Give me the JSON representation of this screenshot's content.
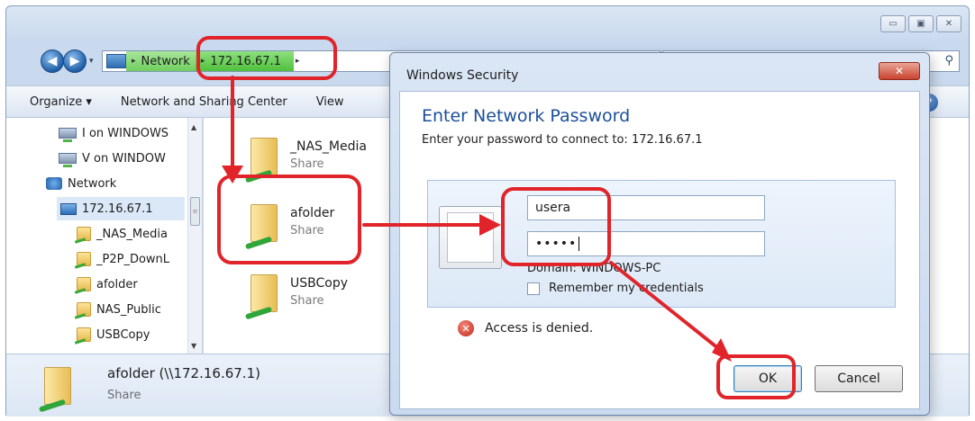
{
  "explorer": {
    "window_controls": [
      "▭",
      "▣",
      "✕"
    ],
    "nav": {
      "back_glyph": "◀",
      "forward_glyph": "▶",
      "dropdown_glyph": "▾"
    },
    "address": {
      "crumbs": [
        "Network",
        "172.16.67.1"
      ],
      "crumb_sep": "▸",
      "crumb_tail": "▸"
    },
    "search_glyph": "⚲",
    "toolbar": {
      "organize": "Organize ▾",
      "network_sharing": "Network and Sharing Center",
      "view": "View"
    },
    "help_glyph": "?",
    "sidebar": {
      "items": [
        {
          "label": "I on WINDOWS",
          "icon": "network-drive-icon"
        },
        {
          "label": "V on WINDOW",
          "icon": "network-drive-icon"
        },
        {
          "label": "Network",
          "icon": "network-icon"
        },
        {
          "label": "172.16.67.1",
          "icon": "computer-icon",
          "selected": true
        },
        {
          "label": "_NAS_Media",
          "icon": "shared-folder-icon"
        },
        {
          "label": "_P2P_DownL",
          "icon": "shared-folder-icon"
        },
        {
          "label": "afolder",
          "icon": "shared-folder-icon"
        },
        {
          "label": "NAS_Public",
          "icon": "shared-folder-icon"
        },
        {
          "label": "USBCopy",
          "icon": "shared-folder-icon"
        }
      ],
      "scroll_up": "▲",
      "scroll_down": "▼",
      "scroll_grip": "≡"
    },
    "content": {
      "items": [
        {
          "name": "_NAS_Media",
          "type": "Share"
        },
        {
          "name": "afolder",
          "type": "Share"
        },
        {
          "name": "USBCopy",
          "type": "Share"
        }
      ]
    },
    "details": {
      "name": "afolder (\\\\172.16.67.1)",
      "type": "Share"
    }
  },
  "dialog": {
    "title": "Windows Security",
    "close_glyph": "✕",
    "heading": "Enter Network Password",
    "subtitle": "Enter your password to connect to: 172.16.67.1",
    "username": "usera",
    "password_mask": "•••••",
    "domain": "Domain: WINDOWS-PC",
    "remember_label": "Remember my credentials",
    "error_glyph": "✕",
    "error_text": "Access is denied.",
    "ok_label": "OK",
    "cancel_label": "Cancel"
  },
  "annotation_color": "#e0242a"
}
